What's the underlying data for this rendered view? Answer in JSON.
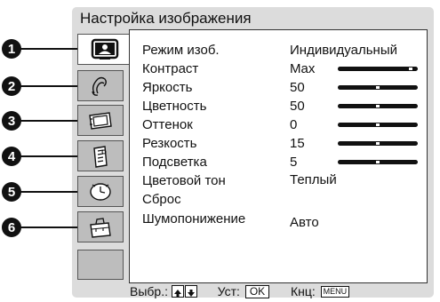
{
  "menu": {
    "title": "Настройка изображения"
  },
  "markers": [
    "1",
    "2",
    "3",
    "4",
    "5",
    "6"
  ],
  "tabs": [
    {
      "icon": "picture-icon",
      "active": true
    },
    {
      "icon": "sound-icon",
      "active": false
    },
    {
      "icon": "screen-icon",
      "active": false
    },
    {
      "icon": "settings-icon",
      "active": false
    },
    {
      "icon": "clock-icon",
      "active": false
    },
    {
      "icon": "toolbox-icon",
      "active": false
    },
    {
      "icon": "",
      "active": false
    }
  ],
  "settings": [
    {
      "label": "Режим изоб.",
      "value": "Индивидуальный"
    },
    {
      "label": "Контраст",
      "value": "Max",
      "level": 1.0
    },
    {
      "label": "Яркость",
      "value": "50",
      "level": 0.5
    },
    {
      "label": "Цветность",
      "value": "50",
      "level": 0.5
    },
    {
      "label": "Оттенок",
      "value": "0",
      "level": 0.5
    },
    {
      "label": "Резкость",
      "value": "15",
      "level": 0.5
    },
    {
      "label": "Подсветка",
      "value": "5",
      "level": 0.5
    },
    {
      "label": "Цветовой тон",
      "value": "Теплый"
    },
    {
      "label": "Сброс",
      "value": ""
    },
    {
      "label": "Шумопонижение",
      "value": "Авто"
    }
  ],
  "footer": {
    "select_label": "Выбр.:",
    "set_label": "Уст:",
    "set_key": "OK",
    "exit_label": "Кнц:",
    "exit_key": "MENU"
  },
  "colors": {
    "panel": "#dcdcdc",
    "tab": "#bdbdbd",
    "text": "#111111"
  }
}
